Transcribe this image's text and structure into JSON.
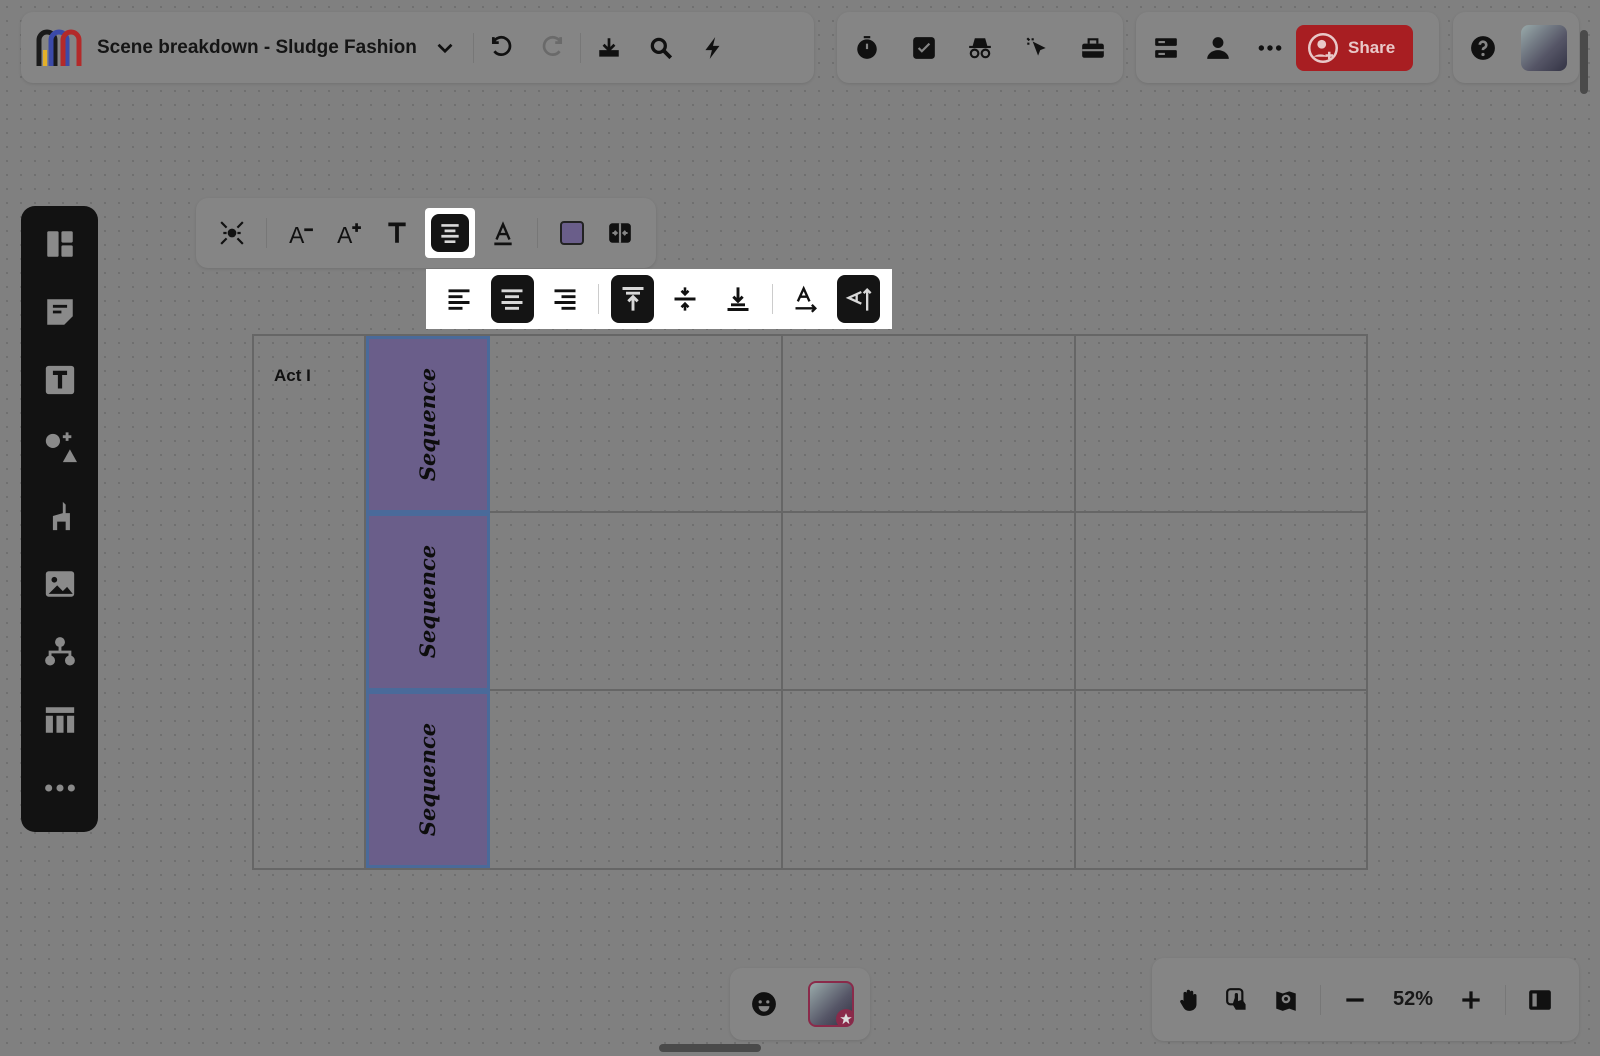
{
  "board": {
    "title": "Scene breakdown - Sludge Fashion"
  },
  "header": {
    "share_label": "Share"
  },
  "table": {
    "act_label": "Act I",
    "sequence_labels": [
      "Sequence",
      "Sequence",
      "Sequence"
    ]
  },
  "zoom": {
    "level": "52%"
  },
  "colors": {
    "canvas": "#808080",
    "share_button": "#a81e22",
    "sequence_fill": "#6a5e8a",
    "selection_border": "#4a6a9a"
  }
}
